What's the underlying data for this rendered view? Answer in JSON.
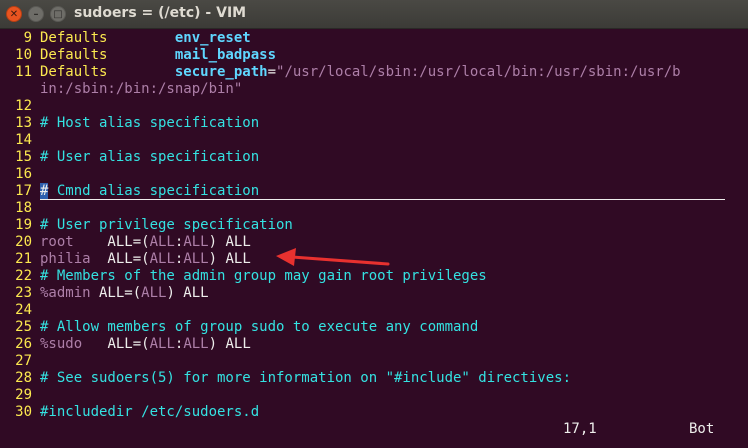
{
  "window": {
    "title": "sudoers = (/etc) - VIM",
    "close_glyph": "✕",
    "min_glyph": "–",
    "max_glyph": "□"
  },
  "lines": [
    {
      "n": "9",
      "p": [
        [
          "Defaults        ",
          "kw"
        ],
        [
          "env_reset",
          "ident"
        ]
      ]
    },
    {
      "n": "10",
      "p": [
        [
          "Defaults        ",
          "kw"
        ],
        [
          "mail_badpass",
          "ident"
        ]
      ]
    },
    {
      "n": "11",
      "p": [
        [
          "Defaults        ",
          "kw"
        ],
        [
          "secure_path",
          "ident"
        ],
        [
          "=",
          "txt"
        ],
        [
          "\"/usr/local/sbin:/usr/local/bin:/usr/sbin:/usr/b",
          "str"
        ]
      ]
    },
    {
      "n": "",
      "p": [
        [
          "in:/sbin:/bin:/snap/bin\"",
          "str"
        ]
      ]
    },
    {
      "n": "12",
      "p": []
    },
    {
      "n": "13",
      "p": [
        [
          "# Host alias specification",
          "comment"
        ]
      ]
    },
    {
      "n": "14",
      "p": []
    },
    {
      "n": "15",
      "p": [
        [
          "# User alias specification",
          "comment"
        ]
      ]
    },
    {
      "n": "16",
      "p": []
    },
    {
      "n": "17",
      "p": [
        [
          "#",
          "comment cursor"
        ],
        [
          " Cmnd alias specification",
          "comment"
        ]
      ]
    },
    {
      "n": "18",
      "p": []
    },
    {
      "n": "19",
      "p": [
        [
          "# User privilege specification",
          "comment"
        ]
      ]
    },
    {
      "n": "20",
      "p": [
        [
          "root",
          "ph"
        ],
        [
          "    ALL=(",
          "txt"
        ],
        [
          "ALL",
          "ph"
        ],
        [
          ":",
          "txt"
        ],
        [
          "ALL",
          "ph"
        ],
        [
          ") ALL",
          "txt"
        ]
      ]
    },
    {
      "n": "21",
      "p": [
        [
          "philia",
          "ph"
        ],
        [
          "  ALL=(",
          "txt"
        ],
        [
          "ALL",
          "ph"
        ],
        [
          ":",
          "txt"
        ],
        [
          "ALL",
          "ph"
        ],
        [
          ") ALL",
          "txt"
        ]
      ]
    },
    {
      "n": "22",
      "p": [
        [
          "# Members of the admin group may gain root privileges",
          "comment"
        ]
      ]
    },
    {
      "n": "23",
      "p": [
        [
          "%admin",
          "ph"
        ],
        [
          " ALL=(",
          "txt"
        ],
        [
          "ALL",
          "ph"
        ],
        [
          ") ALL",
          "txt"
        ]
      ]
    },
    {
      "n": "24",
      "p": []
    },
    {
      "n": "25",
      "p": [
        [
          "# Allow members of group sudo to execute any command",
          "comment"
        ]
      ]
    },
    {
      "n": "26",
      "p": [
        [
          "%sudo",
          "ph"
        ],
        [
          "   ALL=(",
          "txt"
        ],
        [
          "ALL",
          "ph"
        ],
        [
          ":",
          "txt"
        ],
        [
          "ALL",
          "ph"
        ],
        [
          ") ALL",
          "txt"
        ]
      ]
    },
    {
      "n": "27",
      "p": []
    },
    {
      "n": "28",
      "p": [
        [
          "# See sudoers(5) for more information on \"#include\" directives:",
          "comment"
        ]
      ]
    },
    {
      "n": "29",
      "p": []
    },
    {
      "n": "30",
      "p": [
        [
          "#includedir /etc/sudoers.d",
          "comment"
        ]
      ]
    }
  ],
  "status": {
    "position": "17,1",
    "scroll": "Bot"
  },
  "annotation": {
    "arrow_color": "#e8312f"
  }
}
